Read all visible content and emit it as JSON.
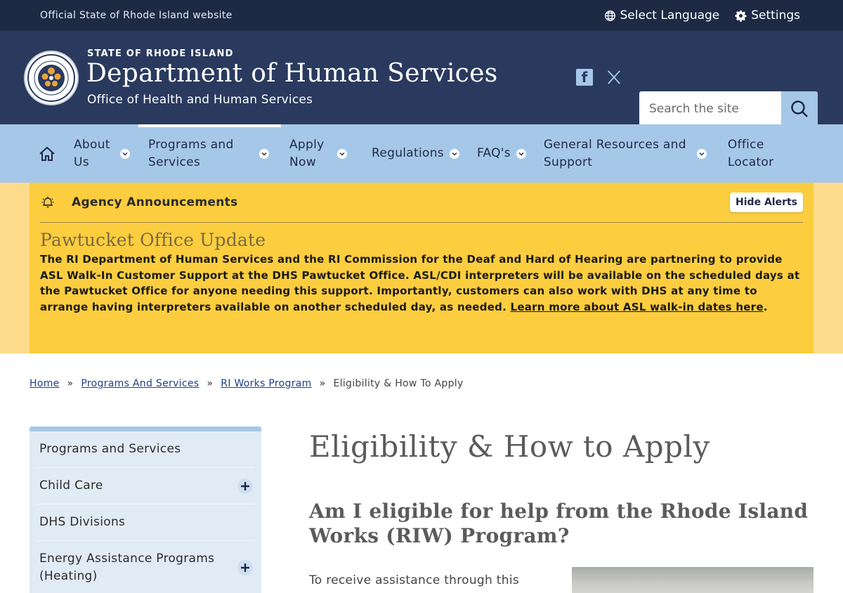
{
  "utility": {
    "official": "Official State of Rhode Island website",
    "language": "Select Language",
    "settings": "Settings"
  },
  "header": {
    "state": "STATE OF RHODE ISLAND",
    "department": "Department of Human Services",
    "office": "Office of Health and Human Services",
    "search_placeholder": "Search the site"
  },
  "nav": {
    "items": [
      {
        "label": "About Us"
      },
      {
        "label": "Programs and Services"
      },
      {
        "label": "Apply Now"
      },
      {
        "label": "Regulations"
      },
      {
        "label": "FAQ's"
      },
      {
        "label": "General Resources and Support"
      },
      {
        "label": "Office Locator"
      }
    ]
  },
  "alert": {
    "title": "Agency Announcements",
    "hide": "Hide Alerts",
    "heading": "Pawtucket Office Update",
    "body": "The RI Department of Human Services and the RI Commission for the Deaf and Hard of Hearing are partnering to provide ASL Walk-In Customer Support at the DHS Pawtucket Office. ASL/CDI interpreters will be available on the scheduled days at the Pawtucket Office for anyone needing this support. Importantly, customers can also work with DHS at any time to arrange having interpreters available on another scheduled day, as needed. ",
    "link": "Learn more about ASL walk-in dates here",
    "end": "."
  },
  "breadcrumb": {
    "home": "Home",
    "programs": "Programs And Services",
    "riworks": "RI Works Program",
    "current": "Eligibility & How To Apply",
    "sep": "»"
  },
  "sidebar": {
    "items": [
      {
        "label": "Programs and Services"
      },
      {
        "label": "Child Care"
      },
      {
        "label": "DHS Divisions"
      },
      {
        "label": "Energy Assistance Programs (Heating)"
      }
    ]
  },
  "content": {
    "title": "Eligibility & How to Apply",
    "question": "Am I eligible for help from the Rhode Island Works (RIW) Program?",
    "para": "To receive assistance through this program:"
  },
  "colors": {
    "top_bar": "#1e2a44",
    "header": "#2a3a5e",
    "nav": "#a6c8e8",
    "alert": "#fbcd3f",
    "alert_outer": "#fcdc8a",
    "sidebar": "#e1ebf5"
  }
}
